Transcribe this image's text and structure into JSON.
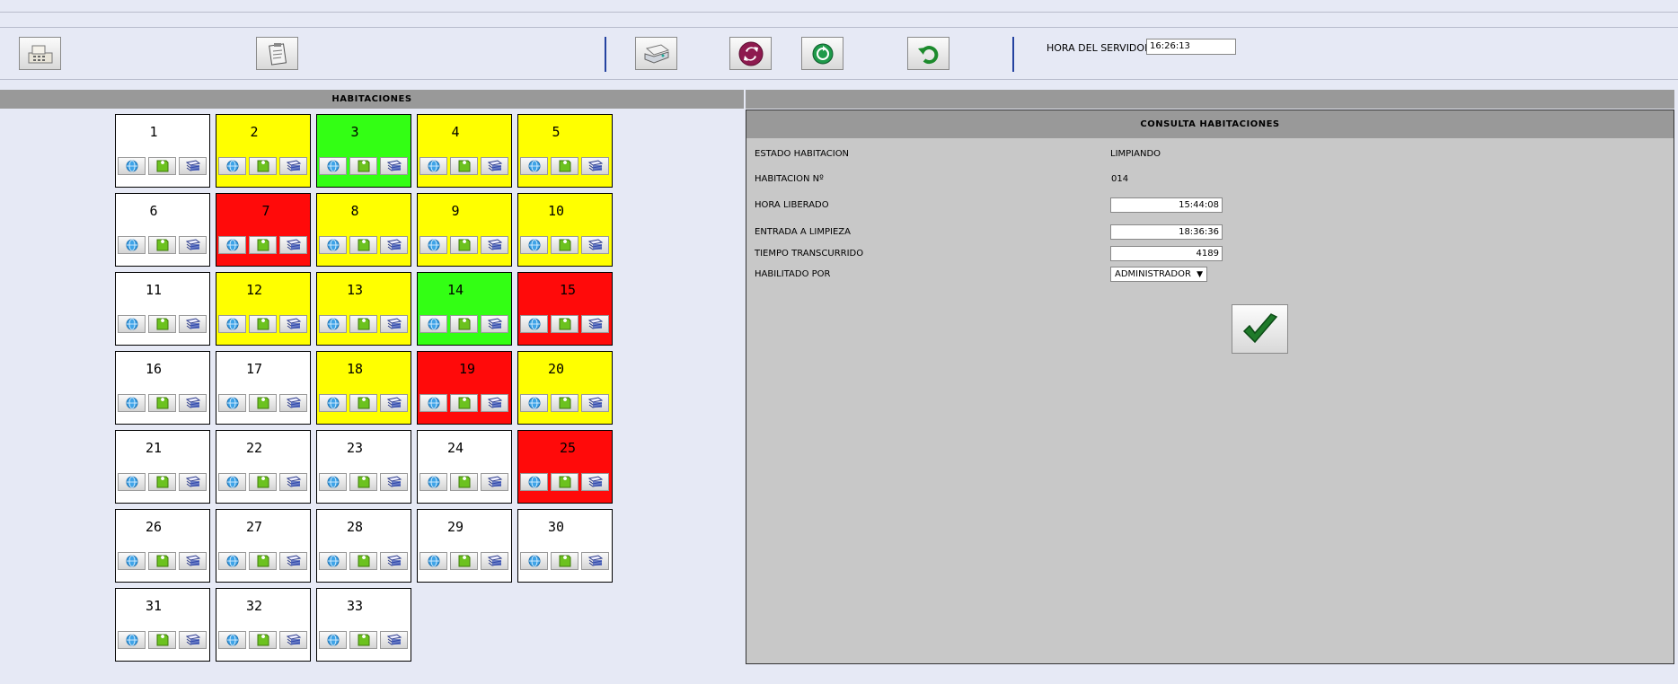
{
  "toolbar": {
    "buttons": [
      {
        "name": "cash-register-button",
        "icon": "cash-register-icon"
      },
      {
        "name": "clipboard-button",
        "icon": "clipboard-icon"
      },
      {
        "name": "printer-button",
        "icon": "printer-icon"
      },
      {
        "name": "exchange-button",
        "icon": "exchange-icon"
      },
      {
        "name": "refresh-button",
        "icon": "refresh-icon"
      },
      {
        "name": "undo-button",
        "icon": "undo-icon"
      }
    ],
    "server_time_label": "HORA DEL SERVIDOR",
    "server_time_value": "16:26:13"
  },
  "rooms": {
    "title": "HABITACIONES",
    "items": [
      {
        "number": "1",
        "status": "white"
      },
      {
        "number": "2",
        "status": "yellow"
      },
      {
        "number": "3",
        "status": "green"
      },
      {
        "number": "4",
        "status": "yellow"
      },
      {
        "number": "5",
        "status": "yellow"
      },
      {
        "number": "6",
        "status": "white"
      },
      {
        "number": "7",
        "status": "red"
      },
      {
        "number": "8",
        "status": "yellow"
      },
      {
        "number": "9",
        "status": "yellow"
      },
      {
        "number": "10",
        "status": "yellow"
      },
      {
        "number": "11",
        "status": "white"
      },
      {
        "number": "12",
        "status": "yellow"
      },
      {
        "number": "13",
        "status": "yellow"
      },
      {
        "number": "14",
        "status": "green"
      },
      {
        "number": "15",
        "status": "red"
      },
      {
        "number": "16",
        "status": "white"
      },
      {
        "number": "17",
        "status": "white"
      },
      {
        "number": "18",
        "status": "yellow"
      },
      {
        "number": "19",
        "status": "red"
      },
      {
        "number": "20",
        "status": "yellow"
      },
      {
        "number": "21",
        "status": "white"
      },
      {
        "number": "22",
        "status": "white"
      },
      {
        "number": "23",
        "status": "white"
      },
      {
        "number": "24",
        "status": "white"
      },
      {
        "number": "25",
        "status": "red"
      },
      {
        "number": "26",
        "status": "white"
      },
      {
        "number": "27",
        "status": "white"
      },
      {
        "number": "28",
        "status": "white"
      },
      {
        "number": "29",
        "status": "white"
      },
      {
        "number": "30",
        "status": "white"
      },
      {
        "number": "31",
        "status": "white"
      },
      {
        "number": "32",
        "status": "white"
      },
      {
        "number": "33",
        "status": "white"
      }
    ],
    "button_icons": [
      "globe-icon",
      "green-ticket-icon",
      "stack-icon"
    ]
  },
  "status_colors": {
    "white": "#ffffff",
    "yellow": "#ffff00",
    "green": "#33ff14",
    "red": "#ff0a0a"
  },
  "panel": {
    "title": "CONSULTA HABITACIONES",
    "estado_label": "ESTADO HABITACION",
    "estado_value": "LIMPIANDO",
    "habitacion_label": "HABITACION Nº",
    "habitacion_value": "014",
    "hora_liberado_label": "HORA LIBERADO",
    "hora_liberado_value": "15:44:08",
    "entrada_label": "ENTRADA A LIMPIEZA",
    "entrada_value": "18:36:36",
    "tiempo_label": "TIEMPO TRANSCURRIDO",
    "tiempo_value": "4189",
    "habilitado_label": "HABILITADO POR",
    "habilitado_value": "ADMINISTRADOR",
    "confirm_icon": "checkmark-icon"
  }
}
